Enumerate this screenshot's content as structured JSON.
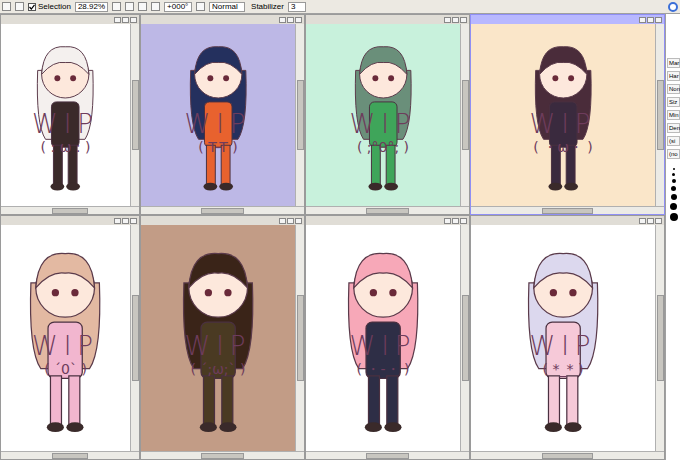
{
  "toolbar": {
    "selection_label": "Selection",
    "selection_checked": true,
    "zoom": "28.92%",
    "rotation": "+000°",
    "blend_mode": "Normal",
    "stabilizer_label": "Stabilizer",
    "stabilizer": "3"
  },
  "canvases": [
    {
      "text": "WIP",
      "face": "( : ω : )",
      "color": "#ffffff",
      "accent": "#f4f0ee",
      "outfit": "#3a2a2a",
      "active": false
    },
    {
      "text": "WIP",
      "face": "( T-T )",
      "color": "#bdb8e6",
      "accent": "#24305e",
      "outfit": "#e8622e",
      "active": false
    },
    {
      "text": "WIP",
      "face": "( ;°0°; )",
      "color": "#c8f1dc",
      "accent": "#6a8f7a",
      "outfit": "#3fa55a",
      "active": false
    },
    {
      "text": "WIP",
      "face": "( ・ω・ )",
      "color": "#fae6c9",
      "accent": "#4a2c3a",
      "outfit": "#3a2a3e",
      "active": true
    },
    {
      "text": "WIP",
      "face": "( ´0` )",
      "color": "#ffffff",
      "accent": "#e3b9a2",
      "outfit": "#f2b6cf",
      "active": false
    },
    {
      "text": "WIP",
      "face": "( ´;ω;` )",
      "color": "#c29c86",
      "accent": "#3a2418",
      "outfit": "#4a3a22",
      "active": false
    },
    {
      "text": "WIP",
      "face": "( ・-・ )",
      "color": "#ffffff",
      "accent": "#f7a8b8",
      "outfit": "#2e2e46",
      "active": false
    },
    {
      "text": "WIP",
      "face": "( *_* )",
      "color": "#ffffff",
      "accent": "#dcd8ee",
      "outfit": "#f6c9d8",
      "active": false
    }
  ],
  "panel": {
    "labels": [
      "Mar",
      "Har",
      "Non",
      "Siz",
      "Min",
      "Den",
      "(si",
      "(no"
    ]
  }
}
